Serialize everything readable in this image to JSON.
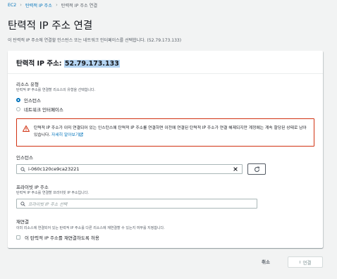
{
  "breadcrumb": {
    "items": [
      "EC2",
      "탄력적 IP 주소",
      "탄력적 IP 주소 연결"
    ]
  },
  "page": {
    "title": "탄력적 IP 주소 연결",
    "description": "이 탄력적 IP 주소에 연결할 인스턴스 또는 네트워크 인터페이스를 선택합니다. (52.79.173.133)"
  },
  "card": {
    "title_prefix": "탄력적 IP 주소: ",
    "ip": "52.79.173.133"
  },
  "resource_type": {
    "label": "리소스 유형",
    "description": "탄력적 IP 주소를 연결할 리소스의 유형을 선택합니다.",
    "options": [
      {
        "label": "인스턴스",
        "selected": true
      },
      {
        "label": "네트워크 인터페이스",
        "selected": false
      }
    ]
  },
  "alert": {
    "message": "탄력적 IP 주소가 이미 연결되어 있는 인스턴스에 탄력적 IP 주소를 연결하면 이전에 연결된 탄력적 IP 주소가 연결 해제되지만 계정에는 계속 할당된 상태로 남아 있습니다. ",
    "link": "자세히 알아보기",
    "icon": "warning-icon"
  },
  "instance": {
    "label": "인스턴스",
    "value": "i-060c120ce9ca23221"
  },
  "private_ip": {
    "label": "프라이빗 IP 주소",
    "description": "탄력적 IP 주소를 연결할 프라이빗 IP 주소입니다.",
    "placeholder": "프라이빗 IP 주소 선택"
  },
  "reassociation": {
    "label": "재연결",
    "description": "이미 리소스에 연결되어 있는 탄력적 IP 주소를 다른 리소스에 재연결할 수 있는지 여부를 지정합니다.",
    "checkbox_label": "이 탄력적 IP 주소를 재연결하도록 허용",
    "checked": false
  },
  "actions": {
    "cancel": "취소",
    "associate": "연결"
  },
  "colors": {
    "link": "#0073bb",
    "warning_border": "#d13212",
    "background": "#f2f3f3",
    "highlight": "#b5d5f3"
  }
}
